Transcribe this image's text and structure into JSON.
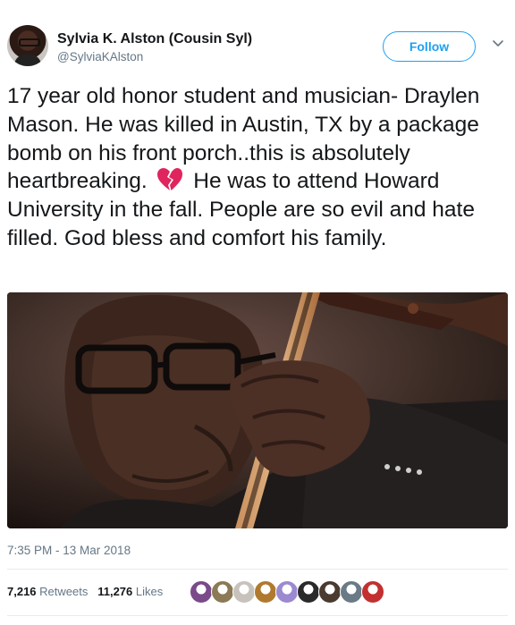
{
  "author": {
    "display_name": "Sylvia K. Alston (Cousin Syl)",
    "handle": "@SylviaKAlston"
  },
  "follow_label": "Follow",
  "tweet": {
    "text_part1": "17 year old honor student and musician- Draylen Mason. He was killed in Austin, TX by a package bomb on his front porch..this is absolutely heartbreaking.",
    "emoji": "broken-heart-icon",
    "text_part2": "He was to attend Howard University in the fall. People are so evil and hate filled. God bless and comfort his family."
  },
  "timestamp": "7:35 PM - 13 Mar 2018",
  "stats": {
    "retweets_count": "7,216",
    "retweets_label": "Retweets",
    "likes_count": "11,276",
    "likes_label": "Likes"
  },
  "colors": {
    "accent": "#1da1f2",
    "secondary_text": "#657786",
    "heart": "#e0245e"
  },
  "likers": [
    {
      "name": "liker-avatar-1",
      "color": "#7a4a8a"
    },
    {
      "name": "liker-avatar-2",
      "color": "#8b7a55"
    },
    {
      "name": "liker-avatar-3",
      "color": "#c8c2bc"
    },
    {
      "name": "liker-avatar-4",
      "color": "#b07a2e"
    },
    {
      "name": "liker-avatar-5",
      "color": "#9b8ad0"
    },
    {
      "name": "liker-avatar-6",
      "color": "#2a2a2a"
    },
    {
      "name": "liker-avatar-7",
      "color": "#4a3a30"
    },
    {
      "name": "liker-avatar-8",
      "color": "#6a7a86"
    },
    {
      "name": "liker-avatar-9",
      "color": "#c23030"
    }
  ]
}
